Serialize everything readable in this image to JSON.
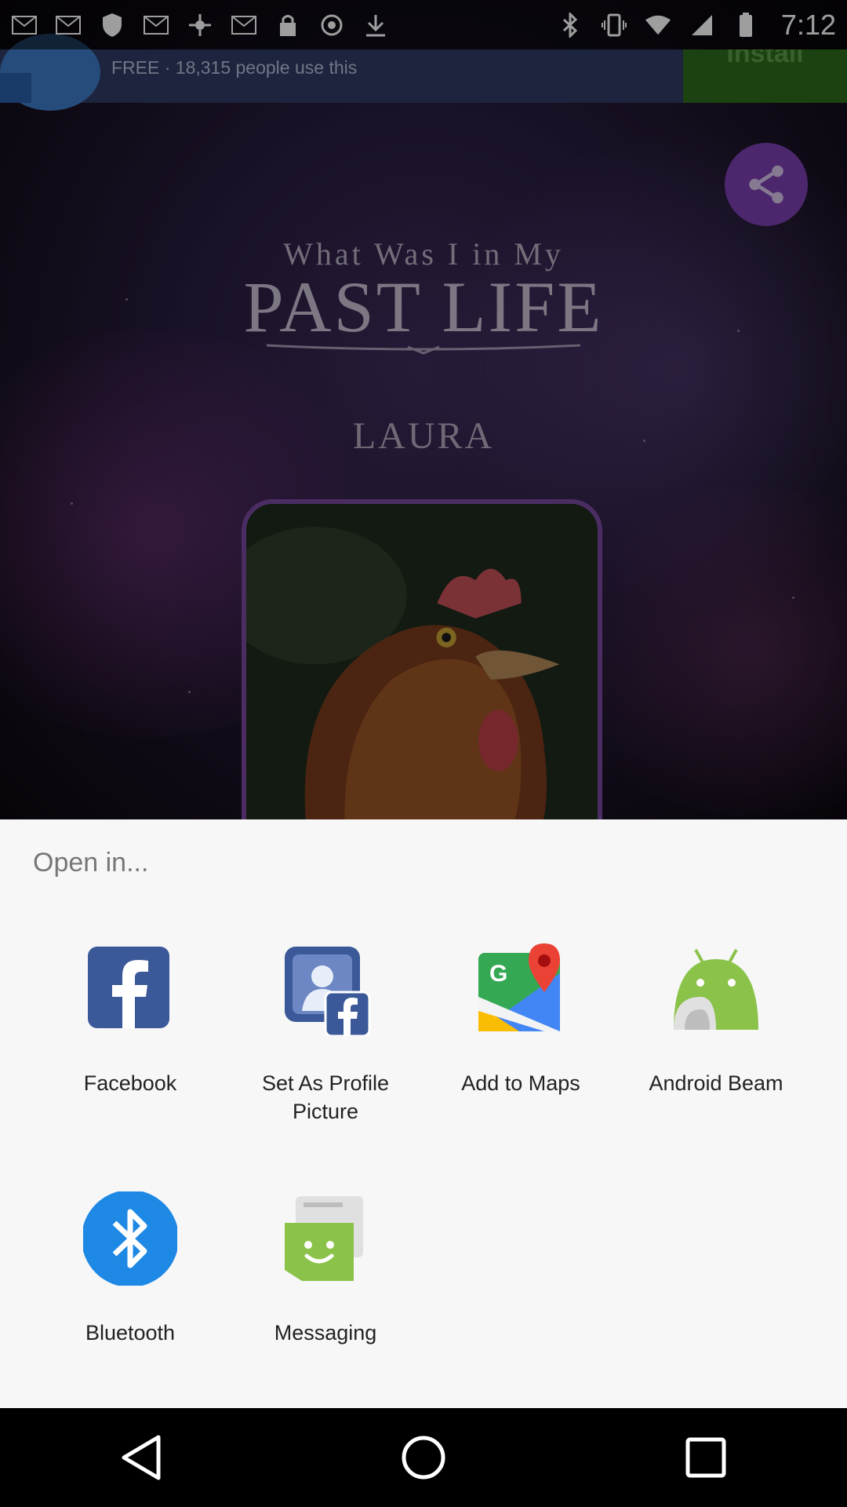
{
  "status_bar": {
    "time": "7:12",
    "left_icons": [
      "mail-icon",
      "mail-icon",
      "shield-icon",
      "mail-icon",
      "fake-gps-icon",
      "mail-icon",
      "lock-icon",
      "rescue-icon",
      "download-icon"
    ],
    "right_icons": [
      "bluetooth-icon",
      "vibrate-icon",
      "wifi-icon",
      "signal-icon",
      "battery-icon"
    ]
  },
  "ad": {
    "text": "FREE · 18,315 people use this",
    "install_label": "Install"
  },
  "background_app": {
    "title_line1": "What Was I in My",
    "title_line2": "PAST LIFE",
    "result_name": "LAURA",
    "share_icon": "share-icon"
  },
  "sheet": {
    "title": "Open in...",
    "apps": [
      {
        "label": "Facebook",
        "icon": "facebook-icon"
      },
      {
        "label": "Set As Profile Picture",
        "icon": "profile-picture-icon"
      },
      {
        "label": "Add to Maps",
        "icon": "maps-icon"
      },
      {
        "label": "Android Beam",
        "icon": "android-beam-icon"
      },
      {
        "label": "Bluetooth",
        "icon": "bluetooth-icon"
      },
      {
        "label": "Messaging",
        "icon": "messaging-icon"
      }
    ]
  },
  "nav": {
    "back": "back-icon",
    "home": "home-icon",
    "recents": "recents-icon"
  },
  "colors": {
    "sheet_bg": "#f7f7f7",
    "facebook": "#3b5998",
    "bluetooth": "#1e88e5",
    "android": "#8bc34a",
    "fab": "#7b3fb0"
  }
}
